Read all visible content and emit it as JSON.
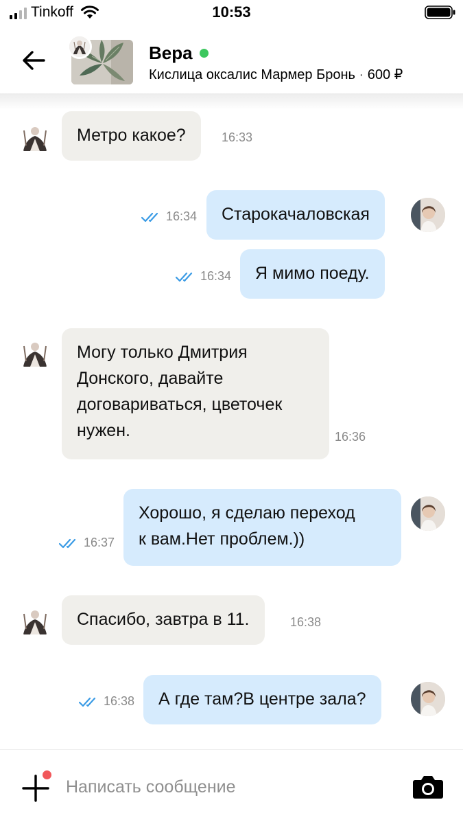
{
  "status": {
    "carrier": "Tinkoff",
    "time": "10:53"
  },
  "header": {
    "name": "Вера",
    "listing": "Кислица оксалис Мармер Бронь",
    "separator": "·",
    "price": "600 ₽"
  },
  "messages": [
    {
      "side": "in",
      "text": "Метро какое?",
      "time": "16:33"
    },
    {
      "side": "out",
      "text": "Старокачаловская",
      "time": "16:34"
    },
    {
      "side": "out",
      "text": "Я мимо поеду.",
      "time": "16:34"
    },
    {
      "side": "in",
      "lines": [
        "Могу только Дмитрия",
        "Донского, давайте",
        "договариваться, цветочек",
        "нужен."
      ],
      "time": "16:36"
    },
    {
      "side": "out",
      "lines": [
        "Хорошо, я сделаю переход",
        "к вам.Нет проблем.))"
      ],
      "time": "16:37"
    },
    {
      "side": "in",
      "text": "Спасибо, завтра в 11.",
      "time": "16:38"
    },
    {
      "side": "out",
      "text": "А где там?В центре зала?",
      "time": "16:38"
    }
  ],
  "input": {
    "placeholder": "Написать сообщение"
  },
  "colors": {
    "incoming_bubble": "#f0efeb",
    "outgoing_bubble": "#d6ebfd",
    "read_check": "#3a9be5",
    "online": "#3cc75e",
    "notification_dot": "#f1575a"
  }
}
